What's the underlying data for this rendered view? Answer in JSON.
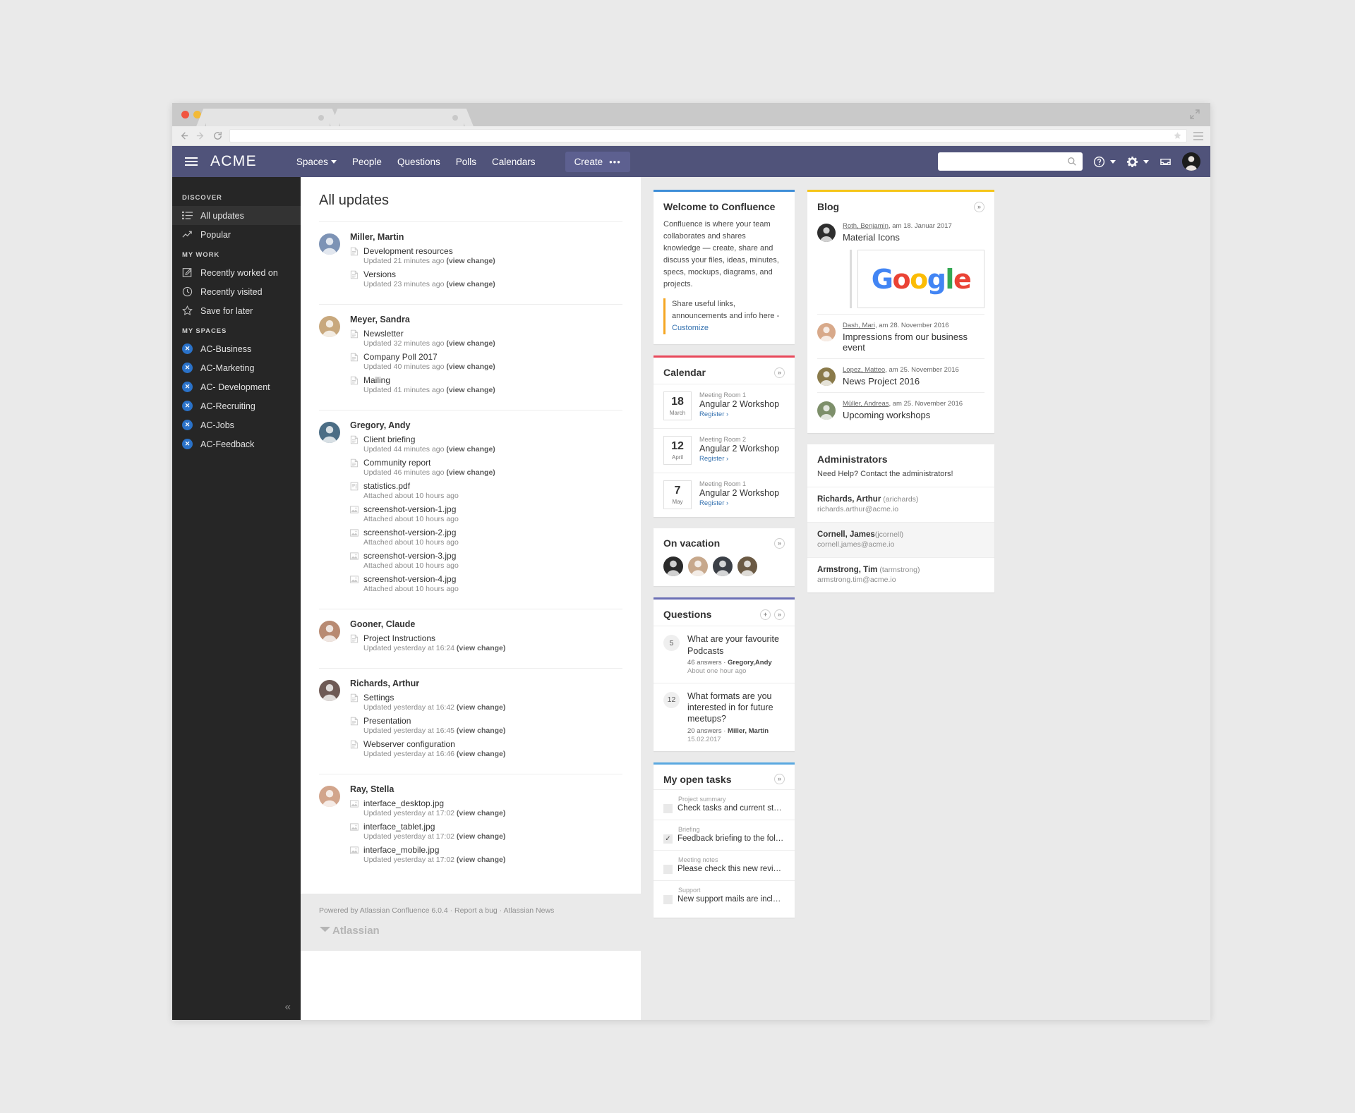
{
  "browser": {
    "url_value": "",
    "tabs": [
      "",
      ""
    ],
    "icons": [
      "back-icon",
      "forward-icon",
      "reload-icon",
      "star-icon",
      "browser-menu-icon",
      "expand-icon"
    ]
  },
  "header": {
    "brand": "ACME",
    "nav": [
      {
        "label": "Spaces",
        "has_caret": true
      },
      {
        "label": "People",
        "has_caret": false
      },
      {
        "label": "Questions",
        "has_caret": false
      },
      {
        "label": "Polls",
        "has_caret": false
      },
      {
        "label": "Calendars",
        "has_caret": false
      }
    ],
    "create_label": "Create",
    "create_more": "•••",
    "search_placeholder": "",
    "search_value": "",
    "bg": "#50537a",
    "create_bg": "#5d6090"
  },
  "sidebar": {
    "sections": [
      {
        "title": "DISCOVER",
        "items": [
          {
            "label": "All updates",
            "icon": "list-icon",
            "active": true
          },
          {
            "label": "Popular",
            "icon": "trending-icon",
            "active": false
          }
        ]
      },
      {
        "title": "MY WORK",
        "items": [
          {
            "label": "Recently worked on",
            "icon": "edit-icon",
            "active": false
          },
          {
            "label": "Recently visited",
            "icon": "clock-icon",
            "active": false
          },
          {
            "label": "Save for later",
            "icon": "star-outline-icon",
            "active": false
          }
        ]
      },
      {
        "title": "MY SPACES",
        "items": [
          {
            "label": "AC-Business",
            "icon": "space-icon",
            "active": false
          },
          {
            "label": "AC-Marketing",
            "icon": "space-icon",
            "active": false
          },
          {
            "label": "AC- Development",
            "icon": "space-icon",
            "active": false
          },
          {
            "label": "AC-Recruiting",
            "icon": "space-icon",
            "active": false
          },
          {
            "label": "AC-Jobs",
            "icon": "space-icon",
            "active": false
          },
          {
            "label": "AC-Feedback",
            "icon": "space-icon",
            "active": false
          }
        ]
      }
    ],
    "collapse": "«"
  },
  "feed": {
    "title": "All updates",
    "groups": [
      {
        "user": "Miller, Martin",
        "avatar": "#7d93b5",
        "items": [
          {
            "name": "Development resources",
            "icon": "page-icon",
            "meta": "Updated 21 minutes ago ",
            "link": "(view change)"
          },
          {
            "name": "Versions",
            "icon": "page-icon",
            "meta": "Updated 23 minutes ago ",
            "link": "(view change)"
          }
        ]
      },
      {
        "user": "Meyer, Sandra",
        "avatar": "#c8a87d",
        "items": [
          {
            "name": "Newsletter",
            "icon": "page-icon",
            "meta": "Updated 32 minutes ago ",
            "link": "(view change)"
          },
          {
            "name": "Company Poll 2017",
            "icon": "page-icon",
            "meta": "Updated 40 minutes ago ",
            "link": "(view change)"
          },
          {
            "name": "Mailing",
            "icon": "page-icon",
            "meta": "Updated 41 minutes ago ",
            "link": "(view change)"
          }
        ]
      },
      {
        "user": "Gregory, Andy",
        "avatar": "#4b6d85",
        "items": [
          {
            "name": "Client briefing",
            "icon": "page-icon",
            "meta": "Updated 44 minutes ago ",
            "link": "(view change)"
          },
          {
            "name": "Community report",
            "icon": "page-icon",
            "meta": "Updated 46 minutes ago ",
            "link": "(view change)"
          },
          {
            "name": "statistics.pdf",
            "icon": "pdf-icon",
            "meta": "Attached about 10 hours ago",
            "link": ""
          },
          {
            "name": "screenshot-version-1.jpg",
            "icon": "image-icon",
            "meta": "Attached about 10 hours ago",
            "link": ""
          },
          {
            "name": "screenshot-version-2.jpg",
            "icon": "image-icon",
            "meta": "Attached about 10 hours ago",
            "link": ""
          },
          {
            "name": "screenshot-version-3.jpg",
            "icon": "image-icon",
            "meta": "Attached about 10 hours ago",
            "link": ""
          },
          {
            "name": "screenshot-version-4.jpg",
            "icon": "image-icon",
            "meta": "Attached about 10 hours ago",
            "link": ""
          }
        ]
      },
      {
        "user": "Gooner, Claude",
        "avatar": "#b88a72",
        "items": [
          {
            "name": "Project Instructions",
            "icon": "page-icon",
            "meta": "Updated yesterday at 16:24 ",
            "link": "(view change)"
          }
        ]
      },
      {
        "user": "Richards, Arthur",
        "avatar": "#6e5a55",
        "items": [
          {
            "name": "Settings",
            "icon": "page-icon",
            "meta": "Updated yesterday at 16:42 ",
            "link": "(view change)"
          },
          {
            "name": "Presentation",
            "icon": "page-icon",
            "meta": "Updated yesterday at 16:45 ",
            "link": "(view change)"
          },
          {
            "name": "Webserver configuration",
            "icon": "page-icon",
            "meta": "Updated yesterday at 16:46 ",
            "link": "(view change)"
          }
        ]
      },
      {
        "user": "Ray, Stella",
        "avatar": "#d2a58c",
        "items": [
          {
            "name": "interface_desktop.jpg",
            "icon": "image-icon",
            "meta": "Updated yesterday at 17:02 ",
            "link": "(view change)"
          },
          {
            "name": "interface_tablet.jpg",
            "icon": "image-icon",
            "meta": "Updated yesterday at 17:02 ",
            "link": "(view change)"
          },
          {
            "name": "interface_mobile.jpg",
            "icon": "image-icon",
            "meta": "Updated yesterday at 17:02 ",
            "link": "(view change)"
          }
        ]
      }
    ],
    "footer": {
      "powered": "Powered by Atlassian Confluence 6.0.4",
      "sep1": "·",
      "report": "Report a bug",
      "sep2": "·",
      "news": "Atlassian News",
      "logo": "Atlassian"
    }
  },
  "welcome": {
    "title": "Welcome to Confluence",
    "body": "Confluence is where your team collaborates and shares knowledge — create, share and discuss your files, ideas, minutes, specs, mockups, diagrams, and projects.",
    "note": "Share useful links, announcements and info here - ",
    "note_link": "Customize",
    "accent": "#3f8fd8"
  },
  "calendar": {
    "title": "Calendar",
    "more": "»",
    "events": [
      {
        "day": "18",
        "month": "March",
        "room": "Meeting Room 1",
        "name": "Angular 2 Workshop",
        "register": "Register ›"
      },
      {
        "day": "12",
        "month": "April",
        "room": "Meeting Room 2",
        "name": "Angular 2 Workshop",
        "register": "Register ›"
      },
      {
        "day": "7",
        "month": "May",
        "room": "Meeting Room 1",
        "name": "Angular 2 Workshop",
        "register": "Register ›"
      }
    ],
    "accent": "#e8485a"
  },
  "vacation": {
    "title": "On vacation",
    "more": "»",
    "people": [
      "#2b2b2b",
      "#c7a88c",
      "#3b3f46",
      "#6b5a44"
    ]
  },
  "questions": {
    "title": "Questions",
    "add": "+",
    "more": "»",
    "accent": "#6b6fb5",
    "items": [
      {
        "count": "5",
        "title": "What are your favourite Podcasts",
        "answers": "46 answers",
        "sep": "·",
        "author": "Gregory,Andy",
        "date": "About one hour ago"
      },
      {
        "count": "12",
        "title": "What formats are you interested in for future meetups?",
        "answers": "20 answers",
        "sep": "·",
        "author": "Miller, Martin",
        "date": "15.02.2017"
      }
    ]
  },
  "tasks": {
    "title": "My open tasks",
    "more": "»",
    "accent": "#5aa8e0",
    "items": [
      {
        "category": "Project summary",
        "text": "Check tasks and current status in this...",
        "checked": false
      },
      {
        "category": "Briefing",
        "text": "Feedback briefing to the following...",
        "checked": true
      },
      {
        "category": "Meeting notes",
        "text": "Please check this new reviewed ticket...",
        "checked": false
      },
      {
        "category": "Support",
        "text": "New support mails are included in the...",
        "checked": false
      }
    ]
  },
  "blog": {
    "title": "Blog",
    "more": "»",
    "accent": "#f5c518",
    "posts": [
      {
        "author": "Roth, Benjamin",
        "date": ", am 18. Januar 2017",
        "title": "Material Icons",
        "avatar": "#2e2e2e",
        "embed": "google-logo"
      },
      {
        "author": "Dash, Mari",
        "date": ", am 28. November 2016",
        "title": "Impressions from our business event",
        "avatar": "#d8a98a",
        "embed": ""
      },
      {
        "author": "Lopez, Matteo",
        "date": ", am 25. November 2016",
        "title": "News Project 2016",
        "avatar": "#8a7a4a",
        "embed": ""
      },
      {
        "author": "Müller, Andreas",
        "date": ", am 25. November 2016",
        "title": "Upcoming workshops",
        "avatar": "#7d8f6a",
        "embed": ""
      }
    ],
    "google": [
      {
        "ch": "G",
        "cls": "g-b"
      },
      {
        "ch": "o",
        "cls": "g-r"
      },
      {
        "ch": "o",
        "cls": "g-y"
      },
      {
        "ch": "g",
        "cls": "g-b"
      },
      {
        "ch": "l",
        "cls": "g-g"
      },
      {
        "ch": "e",
        "cls": "g-r"
      }
    ]
  },
  "administrators": {
    "title": "Administrators",
    "subtitle": "Need Help? Contact the administrators!",
    "people": [
      {
        "name": "Richards, Arthur",
        "username": " (arichards)",
        "email": "richards.arthur@acme.io",
        "alt": false
      },
      {
        "name": "Cornell, James",
        "username": "(jcornell)",
        "email": "cornell.james@acme.io",
        "alt": true
      },
      {
        "name": "Armstrong, Tim",
        "username": " (tarmstrong)",
        "email": "armstrong.tim@acme.io",
        "alt": false
      }
    ]
  }
}
